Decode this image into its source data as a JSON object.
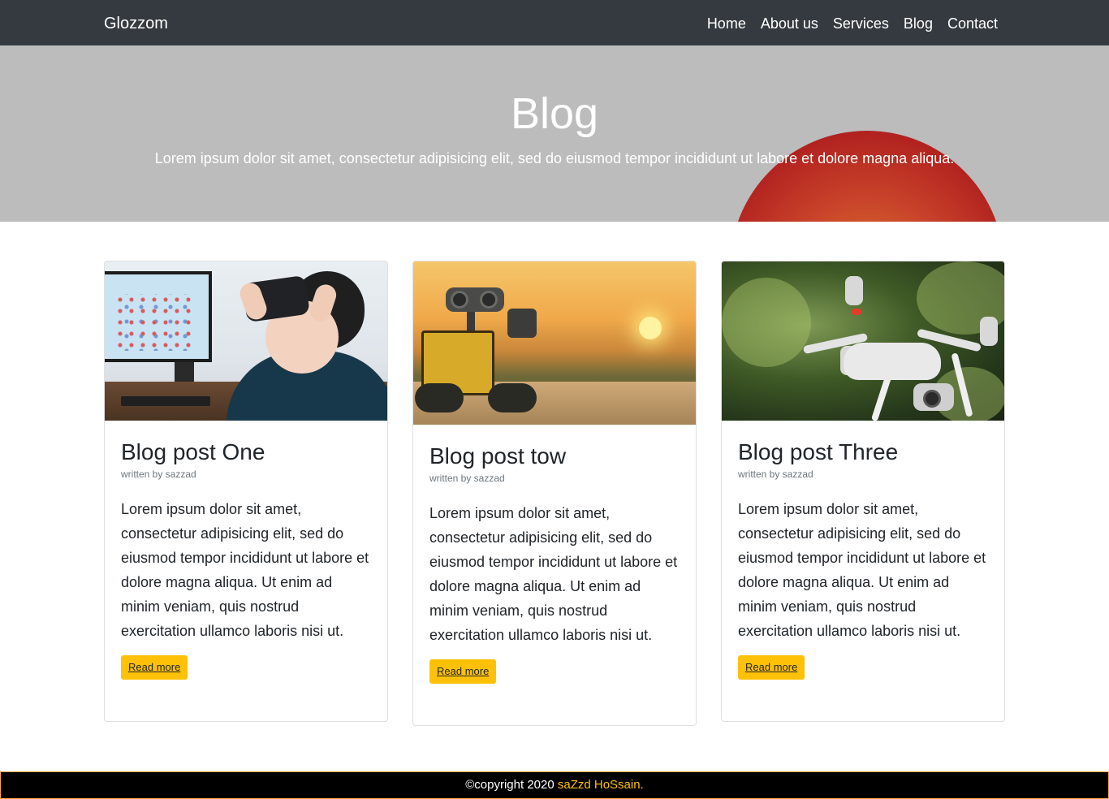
{
  "navbar": {
    "brand": "Glozzom",
    "links": [
      "Home",
      "About us",
      "Services",
      "Blog",
      "Contact"
    ]
  },
  "hero": {
    "title": "Blog",
    "subtitle": "Lorem ipsum dolor sit amet, consectetur adipisicing elit, sed do eiusmod tempor incididunt ut labore et dolore magna aliqua."
  },
  "posts": [
    {
      "title": "Blog post One",
      "author": "written by sazzad",
      "body": "Lorem ipsum dolor sit amet, consectetur adipisicing elit, sed do eiusmod tempor incididunt ut labore et dolore magna aliqua. Ut enim ad minim veniam, quis nostrud exercitation ullamco laboris nisi ut.",
      "button": "Read more"
    },
    {
      "title": "Blog post tow",
      "author": "written by sazzad",
      "body": "Lorem ipsum dolor sit amet, consectetur adipisicing elit, sed do eiusmod tempor incididunt ut labore et dolore magna aliqua. Ut enim ad minim veniam, quis nostrud exercitation ullamco laboris nisi ut.",
      "button": "Read more"
    },
    {
      "title": "Blog post Three",
      "author": "written by sazzad",
      "body": "Lorem ipsum dolor sit amet, consectetur adipisicing elit, sed do eiusmod tempor incididunt ut labore et dolore magna aliqua. Ut enim ad minim veniam, quis nostrud exercitation ullamco laboris nisi ut.",
      "button": "Read more"
    }
  ],
  "footer": {
    "copyright": "©copyright 2020",
    "author": "saZzd HoSsain."
  },
  "colors": {
    "navbar_bg": "#343a40",
    "hero_bg": "#bcbcbc",
    "button_bg": "#ffc107",
    "footer_bg": "#000000",
    "footer_accent": "#ffc107"
  }
}
